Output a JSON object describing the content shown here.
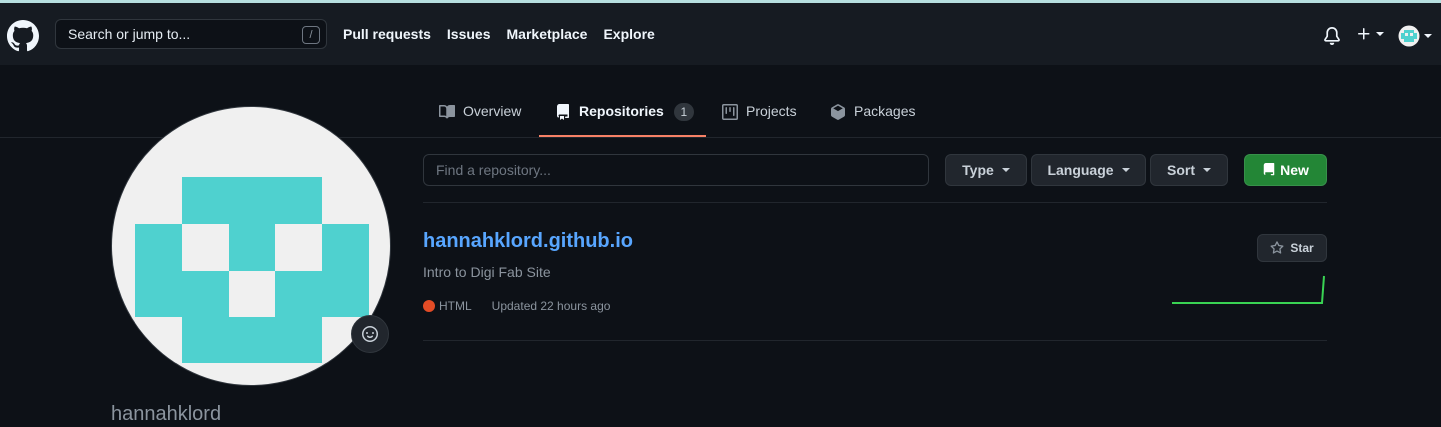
{
  "header": {
    "search_placeholder": "Search or jump to...",
    "search_shortcut": "/",
    "nav": [
      "Pull requests",
      "Issues",
      "Marketplace",
      "Explore"
    ]
  },
  "tabs": [
    {
      "label": "Overview",
      "icon": "book-icon"
    },
    {
      "label": "Repositories",
      "icon": "repo-icon",
      "count": "1",
      "active": true
    },
    {
      "label": "Projects",
      "icon": "project-icon"
    },
    {
      "label": "Packages",
      "icon": "package-icon"
    }
  ],
  "profile": {
    "username": "hannahklord",
    "avatar_color": "#4fd1cf"
  },
  "filters": {
    "find_placeholder": "Find a repository...",
    "type_label": "Type",
    "language_label": "Language",
    "sort_label": "Sort",
    "new_label": "New"
  },
  "repos": [
    {
      "name": "hannahklord.github.io",
      "description": "Intro to Digi Fab Site",
      "language": "HTML",
      "language_color": "#e34c26",
      "updated": "Updated 22 hours ago",
      "star_label": "Star"
    }
  ],
  "colors": {
    "accent_link": "#58a6ff",
    "new_button": "#238636",
    "active_tab_underline": "#f78166"
  }
}
